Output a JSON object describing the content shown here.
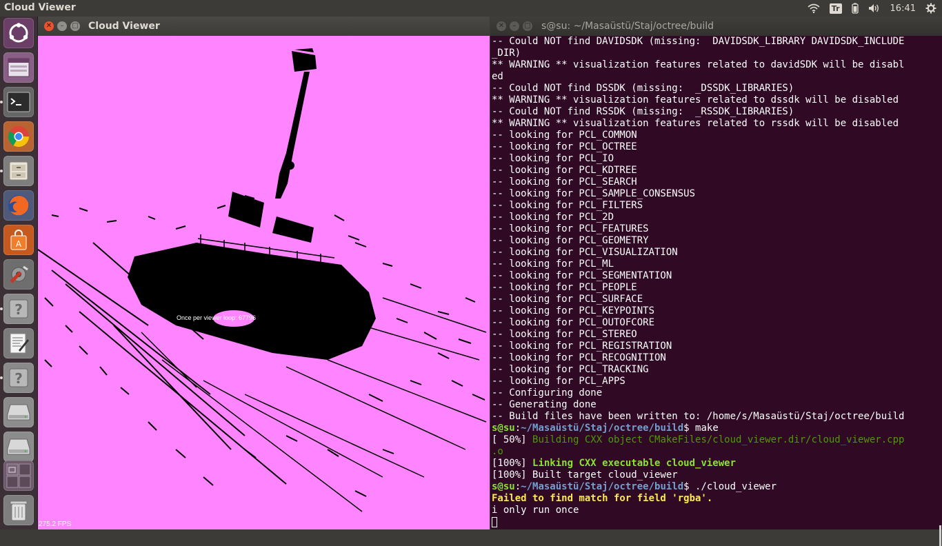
{
  "top_panel": {
    "app_title": "Cloud Viewer",
    "keyboard_layout": "Tr",
    "clock": "16:41"
  },
  "launcher": {
    "items": [
      {
        "name": "dash",
        "icon": "ubuntu-logo-icon"
      },
      {
        "name": "workspace",
        "icon": "window-icon"
      },
      {
        "name": "terminal",
        "icon": "terminal-icon"
      },
      {
        "name": "chrome",
        "icon": "chrome-icon"
      },
      {
        "name": "files",
        "icon": "file-cabinet-icon"
      },
      {
        "name": "firefox",
        "icon": "firefox-icon"
      },
      {
        "name": "software-center",
        "icon": "shopping-bag-icon"
      },
      {
        "name": "system-settings",
        "icon": "gear-wrench-icon"
      },
      {
        "name": "unknown-app-1",
        "icon": "question-mark-icon"
      },
      {
        "name": "text-editor",
        "icon": "text-editor-icon"
      },
      {
        "name": "unknown-app-2",
        "icon": "question-mark-icon"
      },
      {
        "name": "drive-1",
        "icon": "hard-drive-icon"
      },
      {
        "name": "drive-2",
        "icon": "hard-drive-icon"
      },
      {
        "name": "workspace-switcher",
        "icon": "workspace-switcher-icon"
      },
      {
        "name": "trash",
        "icon": "trash-icon"
      }
    ]
  },
  "viewer": {
    "title": "Cloud Viewer",
    "overlay_text": "Once per viewer loop: 67796",
    "fps": "275.2 FPS",
    "background_color": "#ff84ff"
  },
  "terminal": {
    "title": "s@su: ~/Masaüstü/Staj/octree/build",
    "lines": [
      {
        "text": "-- Could NOT find DAVIDSDK (missing:  DAVIDSDK_LIBRARY DAVIDSDK_INCLUDE"
      },
      {
        "text": "_DIR)"
      },
      {
        "text": "** WARNING ** visualization features related to davidSDK will be disabl"
      },
      {
        "text": "ed"
      },
      {
        "text": "-- Could NOT find DSSDK (missing:  _DSSDK_LIBRARIES)"
      },
      {
        "text": "** WARNING ** visualization features related to dssdk will be disabled"
      },
      {
        "text": "-- Could NOT find RSSDK (missing:  _RSSDK_LIBRARIES)"
      },
      {
        "text": "** WARNING ** visualization features related to rssdk will be disabled"
      },
      {
        "text": "-- looking for PCL_COMMON"
      },
      {
        "text": "-- looking for PCL_OCTREE"
      },
      {
        "text": "-- looking for PCL_IO"
      },
      {
        "text": "-- looking for PCL_KDTREE"
      },
      {
        "text": "-- looking for PCL_SEARCH"
      },
      {
        "text": "-- looking for PCL_SAMPLE_CONSENSUS"
      },
      {
        "text": "-- looking for PCL_FILTERS"
      },
      {
        "text": "-- looking for PCL_2D"
      },
      {
        "text": "-- looking for PCL_FEATURES"
      },
      {
        "text": "-- looking for PCL_GEOMETRY"
      },
      {
        "text": "-- looking for PCL_VISUALIZATION"
      },
      {
        "text": "-- looking for PCL_ML"
      },
      {
        "text": "-- looking for PCL_SEGMENTATION"
      },
      {
        "text": "-- looking for PCL_PEOPLE"
      },
      {
        "text": "-- looking for PCL_SURFACE"
      },
      {
        "text": "-- looking for PCL_KEYPOINTS"
      },
      {
        "text": "-- looking for PCL_OUTOFCORE"
      },
      {
        "text": "-- looking for PCL_STEREO"
      },
      {
        "text": "-- looking for PCL_REGISTRATION"
      },
      {
        "text": "-- looking for PCL_RECOGNITION"
      },
      {
        "text": "-- looking for PCL_TRACKING"
      },
      {
        "text": "-- looking for PCL_APPS"
      },
      {
        "text": "-- Configuring done"
      },
      {
        "text": "-- Generating done"
      },
      {
        "text": "-- Build files have been written to: /home/s/Masaüstü/Staj/octree/build"
      },
      {
        "prompt_user": "s@su",
        "prompt_path": "~/Masaüstü/Staj/octree/build",
        "command": "$ make"
      },
      {
        "prefix": "[ 50%] ",
        "colored": "Building CXX object CMakeFiles/cloud_viewer.dir/cloud_viewer.cpp",
        "style": "olive"
      },
      {
        "colored": ".o",
        "style": "olive"
      },
      {
        "prefix": "[100%] ",
        "colored": "Linking CXX executable cloud_viewer",
        "style": "green"
      },
      {
        "text": "[100%] Built target cloud_viewer"
      },
      {
        "prompt_user": "s@su",
        "prompt_path": "~/Masaüstü/Staj/octree/build",
        "command": "$ ./cloud_viewer"
      },
      {
        "colored": "Failed to find match for field 'rgba'.",
        "style": "yellow"
      },
      {
        "text": "i only run once"
      },
      {
        "cursor": true
      }
    ]
  }
}
